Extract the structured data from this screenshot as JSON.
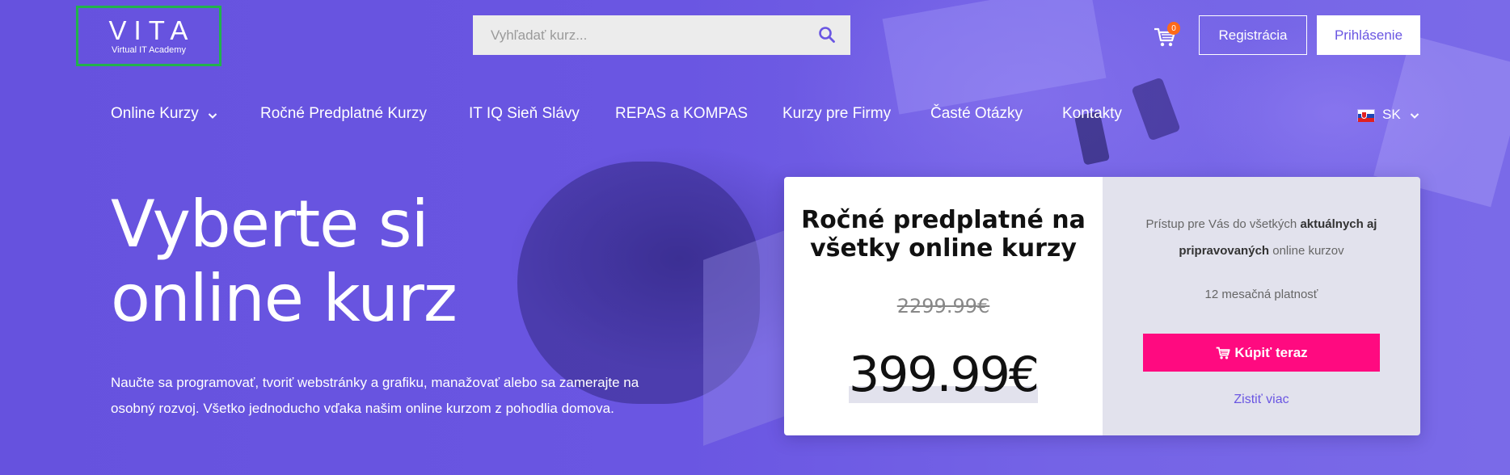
{
  "logo": {
    "title": "VITA",
    "subtitle": "Virtual IT Academy"
  },
  "search": {
    "placeholder": "Vyhľadať kurz...",
    "value": ""
  },
  "cart": {
    "count": "0"
  },
  "header": {
    "register_label": "Registrácia",
    "login_label": "Prihlásenie"
  },
  "nav": {
    "items": [
      {
        "label": "Online Kurzy",
        "has_dropdown": true
      },
      {
        "label": "Ročné Predplatné Kurzy"
      },
      {
        "label": "IT IQ Sieň Slávy"
      },
      {
        "label": "REPAS a KOMPAS"
      },
      {
        "label": "Kurzy pre Firmy"
      },
      {
        "label": "Časté Otázky"
      },
      {
        "label": "Kontakty"
      }
    ],
    "language": "SK"
  },
  "hero": {
    "title": "Vyberte si online kurz",
    "text": "Naučte sa programovať, tvoriť webstránky a grafiku, manažovať alebo sa zamerajte na osobný rozvoj. Všetko jednoducho vďaka našim online kurzom z pohodlia domova."
  },
  "offer": {
    "title": "Ročné predplatné na všetky online kurzy",
    "old_price": "2299.99€",
    "new_price": "399.99€",
    "access_text_1": "Prístup pre Vás do všetkých ",
    "access_bold": "aktuálnych aj pripravovaných",
    "access_text_2": " online kurzov",
    "validity": "12 mesačná platnosť",
    "buy_label": "Kúpiť teraz",
    "more_label": "Zistiť viac"
  },
  "colors": {
    "primary": "#6a56e2",
    "buy_button": "#ff0a80",
    "logo_border": "#22b24c",
    "cart_badge": "#ff6a1a"
  }
}
